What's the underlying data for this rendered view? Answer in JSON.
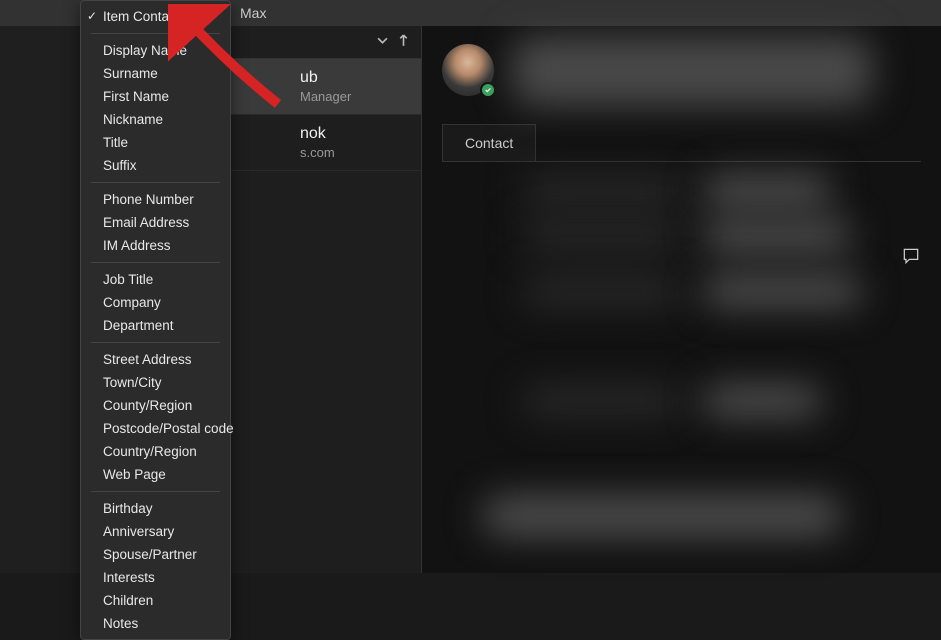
{
  "search": {
    "value": "Max"
  },
  "dropdown": {
    "groups": [
      [
        {
          "label": "Item Contains",
          "checked": true
        }
      ],
      [
        {
          "label": "Display Name"
        },
        {
          "label": "Surname"
        },
        {
          "label": "First Name"
        },
        {
          "label": "Nickname"
        },
        {
          "label": "Title"
        },
        {
          "label": "Suffix"
        }
      ],
      [
        {
          "label": "Phone Number"
        },
        {
          "label": "Email Address"
        },
        {
          "label": "IM Address"
        }
      ],
      [
        {
          "label": "Job Title"
        },
        {
          "label": "Company"
        },
        {
          "label": "Department"
        }
      ],
      [
        {
          "label": "Street Address"
        },
        {
          "label": "Town/City"
        },
        {
          "label": "County/Region"
        },
        {
          "label": "Postcode/Postal code"
        },
        {
          "label": "Country/Region"
        },
        {
          "label": "Web Page"
        }
      ],
      [
        {
          "label": "Birthday"
        },
        {
          "label": "Anniversary"
        },
        {
          "label": "Spouse/Partner"
        },
        {
          "label": "Interests"
        },
        {
          "label": "Children"
        },
        {
          "label": "Notes"
        }
      ]
    ]
  },
  "list": {
    "items": [
      {
        "name_frag": "ub",
        "sub": "Manager",
        "selected": true
      },
      {
        "name_frag": "nok",
        "sub": "s.com",
        "selected": false
      }
    ]
  },
  "tabs": {
    "contact": "Contact"
  },
  "colors": {
    "arrow": "#d62323",
    "presence": "#3ba55d"
  }
}
